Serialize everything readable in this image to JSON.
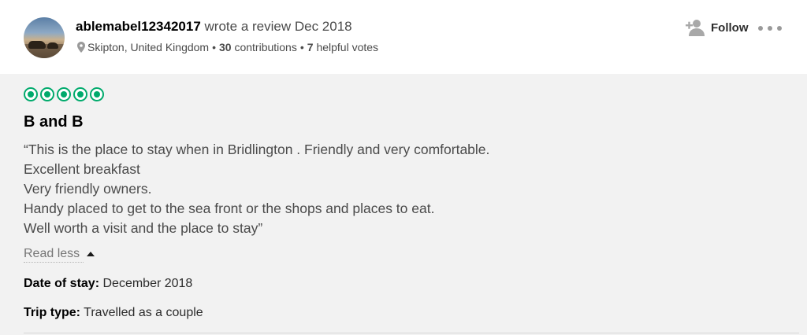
{
  "reviewer": {
    "username": "ablemabel12342017",
    "action": "wrote a review Dec 2018",
    "location": "Skipton, United Kingdom",
    "contributions_count": "30",
    "contributions_label": "contributions",
    "helpful_count": "7",
    "helpful_label": "helpful votes",
    "separator": "•"
  },
  "actions": {
    "follow_label": "Follow"
  },
  "review": {
    "rating": 5,
    "rating_max": 5,
    "title": "B and B",
    "lines": [
      "“This is the place to stay when in Bridlington . Friendly and very comfortable.",
      "Excellent breakfast",
      "Very friendly owners.",
      "Handy placed to get to the sea front or the shops and places to eat.",
      "Well worth a visit and the place to stay”"
    ],
    "read_less_label": "Read less",
    "date_of_stay_label": "Date of stay:",
    "date_of_stay_value": "December 2018",
    "trip_type_label": "Trip type:",
    "trip_type_value": "Travelled as a couple"
  },
  "colors": {
    "rating_accent": "#00aa6c",
    "panel_background": "#f2f2f2"
  }
}
